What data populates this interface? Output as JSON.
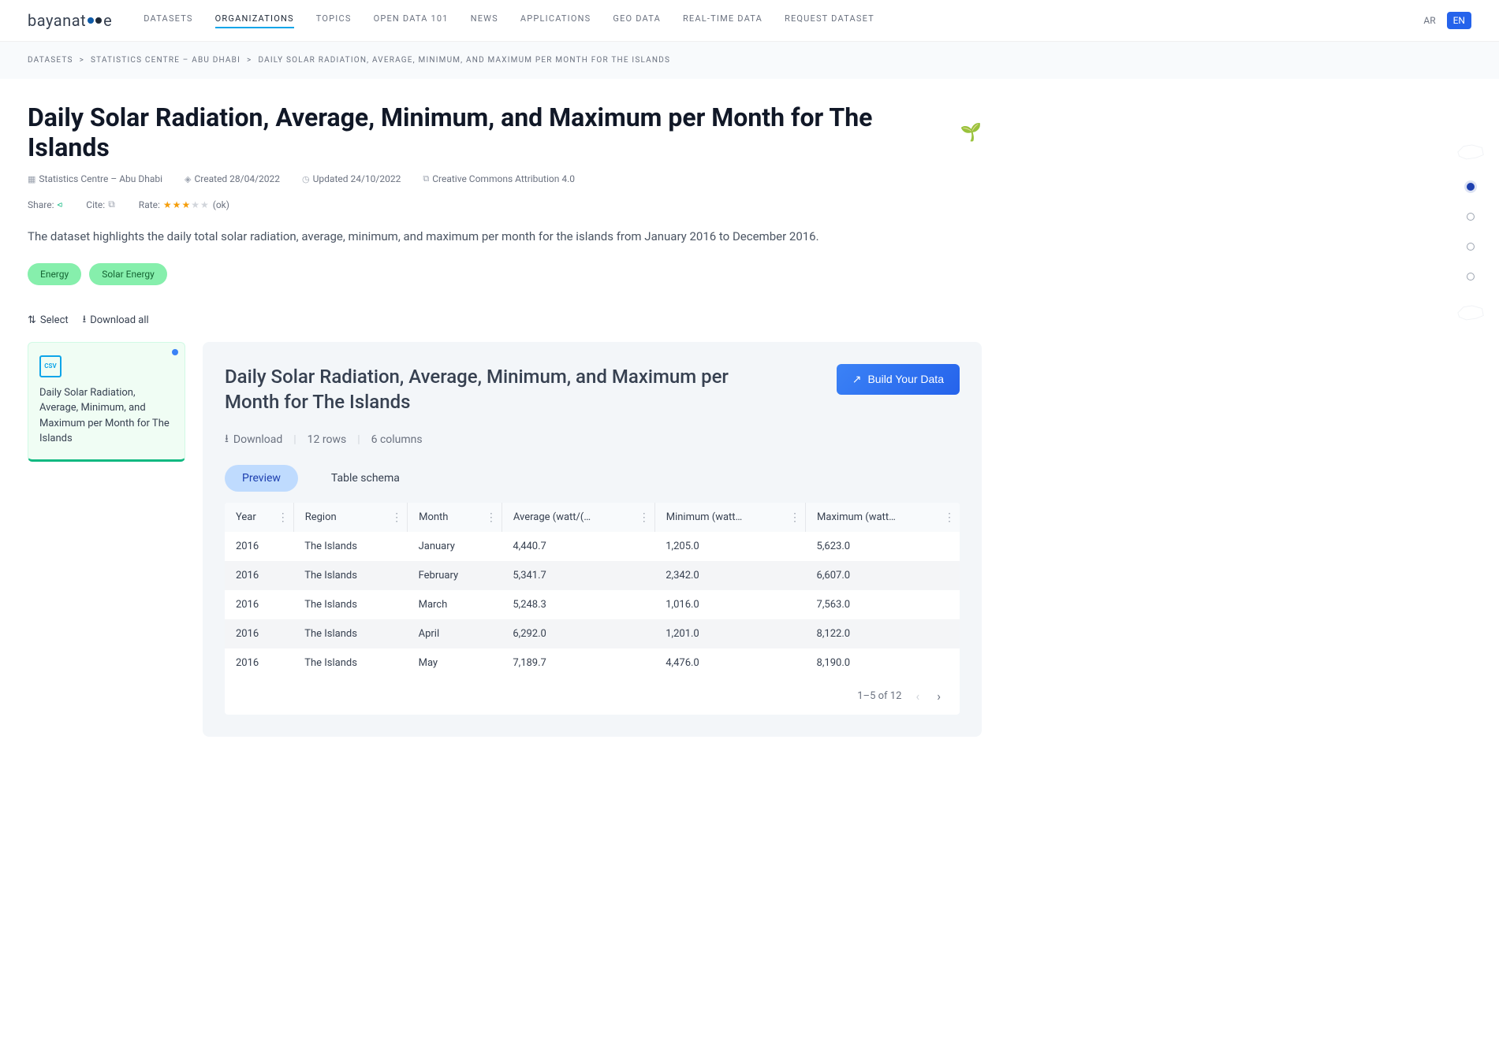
{
  "header": {
    "logo_text": "bayanat",
    "logo_suffix": "e",
    "nav": [
      "DATASETS",
      "ORGANIZATIONS",
      "TOPICS",
      "OPEN DATA 101",
      "NEWS",
      "APPLICATIONS",
      "GEO DATA",
      "REAL-TIME DATA",
      "REQUEST DATASET"
    ],
    "active_nav_index": 1,
    "lang_ar": "AR",
    "lang_en": "EN"
  },
  "breadcrumb": {
    "items": [
      "DATASETS",
      "STATISTICS CENTRE – ABU DHABI",
      "DAILY SOLAR RADIATION, AVERAGE, MINIMUM, AND MAXIMUM PER MONTH FOR THE ISLANDS"
    ]
  },
  "page": {
    "title": "Daily Solar Radiation, Average, Minimum, and Maximum per Month for The Islands",
    "publisher": "Statistics Centre – Abu Dhabi",
    "created": "Created 28/04/2022",
    "updated": "Updated 24/10/2022",
    "license": "Creative Commons Attribution 4.0",
    "share_label": "Share:",
    "cite_label": "Cite:",
    "rate_label": "Rate:",
    "rate_text": "(ok)",
    "description": "The dataset highlights the daily total solar radiation, average, minimum, and maximum per month for the islands from January 2016 to December 2016.",
    "tags": [
      "Energy",
      "Solar Energy"
    ],
    "select_label": "Select",
    "download_all_label": "Download all"
  },
  "resource": {
    "format": "CSV",
    "title": "Daily Solar Radiation, Average, Minimum, and Maximum per Month for The Islands"
  },
  "panel": {
    "title": "Daily Solar Radiation, Average, Minimum, and Maximum per Month for The Islands",
    "build_btn": "Build Your Data",
    "download": "Download",
    "rows_label": "12 rows",
    "cols_label": "6 columns",
    "tab_preview": "Preview",
    "tab_schema": "Table schema"
  },
  "table": {
    "columns": [
      "Year",
      "Region",
      "Month",
      "Average (watt/(…",
      "Minimum (watt…",
      "Maximum (watt…"
    ],
    "rows": [
      [
        "2016",
        "The Islands",
        "January",
        "4,440.7",
        "1,205.0",
        "5,623.0"
      ],
      [
        "2016",
        "The Islands",
        "February",
        "5,341.7",
        "2,342.0",
        "6,607.0"
      ],
      [
        "2016",
        "The Islands",
        "March",
        "5,248.3",
        "1,016.0",
        "7,563.0"
      ],
      [
        "2016",
        "The Islands",
        "April",
        "6,292.0",
        "1,201.0",
        "8,122.0"
      ],
      [
        "2016",
        "The Islands",
        "May",
        "7,189.7",
        "4,476.0",
        "8,190.0"
      ]
    ],
    "footer": "1–5 of 12"
  }
}
